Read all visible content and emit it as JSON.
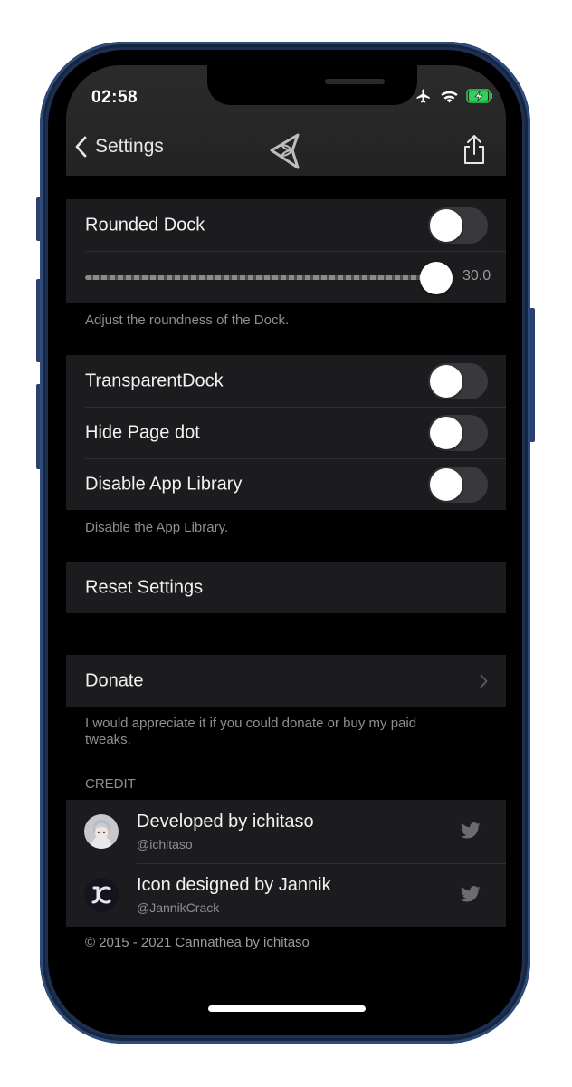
{
  "status_bar": {
    "time": "02:58",
    "icons": [
      "airplane-icon",
      "wifi-icon",
      "battery-charging-icon"
    ]
  },
  "nav": {
    "back_label": "Settings",
    "logo_icon": "cannathea-logo-icon",
    "share_icon": "share-icon"
  },
  "rounded_dock": {
    "label": "Rounded Dock",
    "enabled": false,
    "slider_value": "30.0",
    "slider_position": 1.0,
    "footer": "Adjust the roundness of the Dock."
  },
  "toggles": [
    {
      "label": "TransparentDock",
      "enabled": false
    },
    {
      "label": "Hide Page dot",
      "enabled": false
    },
    {
      "label": "Disable App Library",
      "enabled": false
    }
  ],
  "toggles_footer": "Disable the App Library.",
  "reset_label": "Reset Settings",
  "donate": {
    "label": "Donate",
    "footer": "I would appreciate it if you could donate or buy my paid tweaks."
  },
  "credit": {
    "header": "CREDIT",
    "items": [
      {
        "title": "Developed by ichitaso",
        "handle": "@ichitaso",
        "icon": "twitter-icon"
      },
      {
        "title": "Icon designed by Jannik",
        "handle": "@JannikCrack",
        "icon": "twitter-icon"
      }
    ]
  },
  "copyright": "© 2015 - 2021 Cannathea by ichitaso",
  "colors": {
    "background": "#000000",
    "cell": "#1c1c1e",
    "secondary_text": "#8e8e93",
    "toggle_off": "#39393d",
    "battery_green": "#30d158",
    "frame_blue": "#1d2f52"
  }
}
